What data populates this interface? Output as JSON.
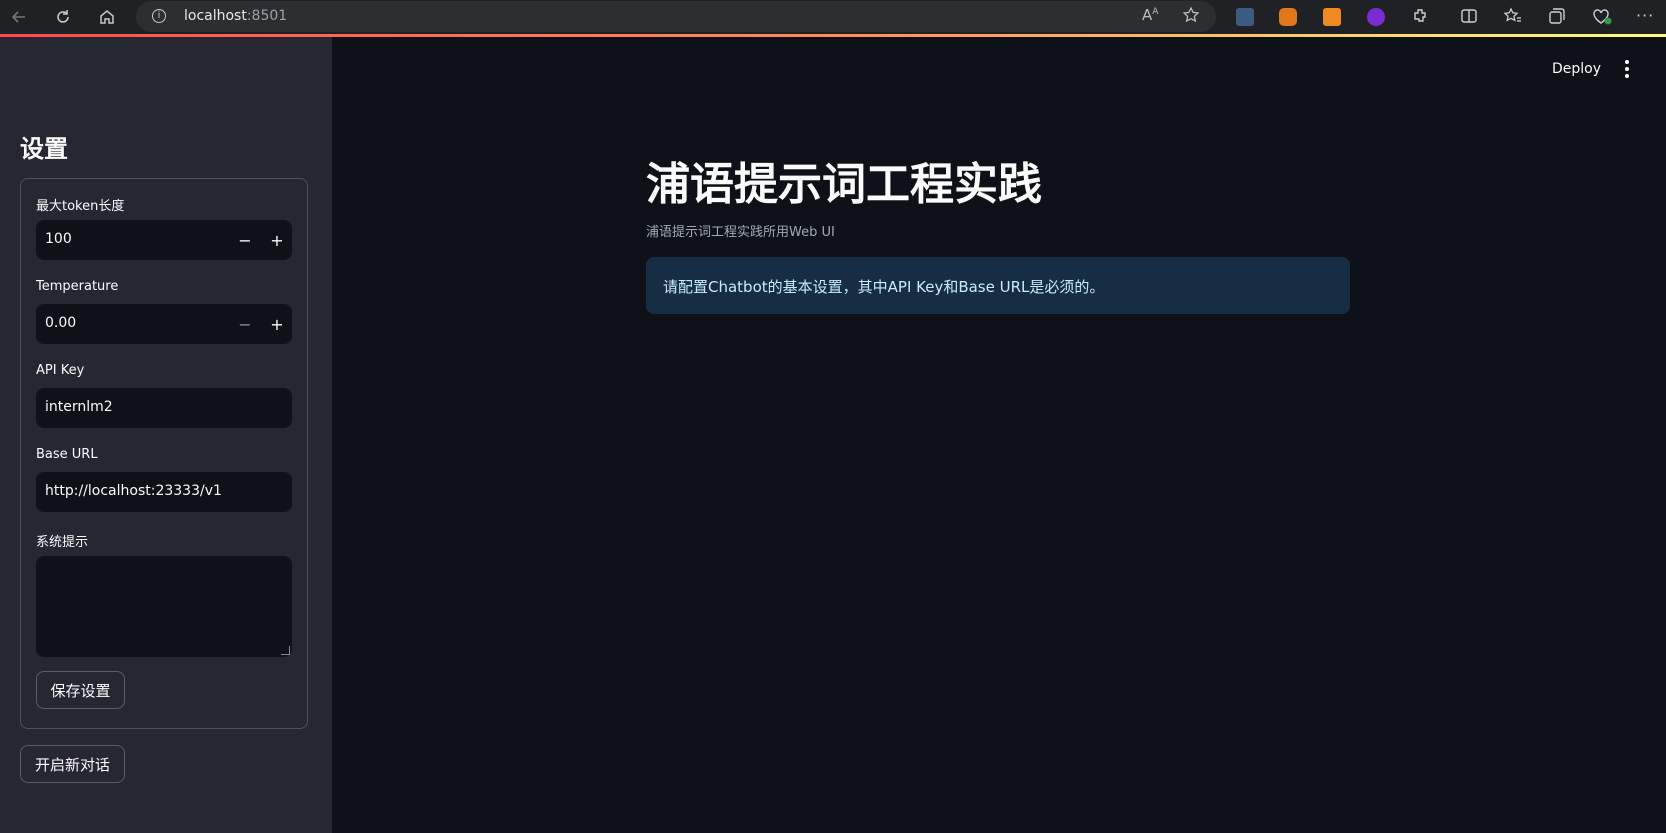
{
  "browser": {
    "url_host": "localhost",
    "url_port": ":8501",
    "read_aloud_label": "Aᴬ"
  },
  "header": {
    "deploy_label": "Deploy"
  },
  "sidebar": {
    "title": "设置",
    "max_tokens": {
      "label": "最大token长度",
      "value": "100",
      "minus": "−",
      "plus": "+"
    },
    "temperature": {
      "label": "Temperature",
      "value": "0.00",
      "minus": "−",
      "plus": "+"
    },
    "api_key": {
      "label": "API Key",
      "value": "internlm2"
    },
    "base_url": {
      "label": "Base URL",
      "value": "http://localhost:23333/v1"
    },
    "system_prompt": {
      "label": "系统提示",
      "value": ""
    },
    "save_label": "保存设置",
    "new_chat_label": "开启新对话"
  },
  "main": {
    "title": "浦语提示词工程实践",
    "caption": "浦语提示词工程实践所用Web UI",
    "info_message": "请配置Chatbot的基本设置，其中API Key和Base URL是必须的。"
  },
  "colors": {
    "background": "#0e1117",
    "sidebar": "#262730",
    "info_bg": "#172d43",
    "info_text": "#c7ebff",
    "accent": "#ff4b4b"
  }
}
